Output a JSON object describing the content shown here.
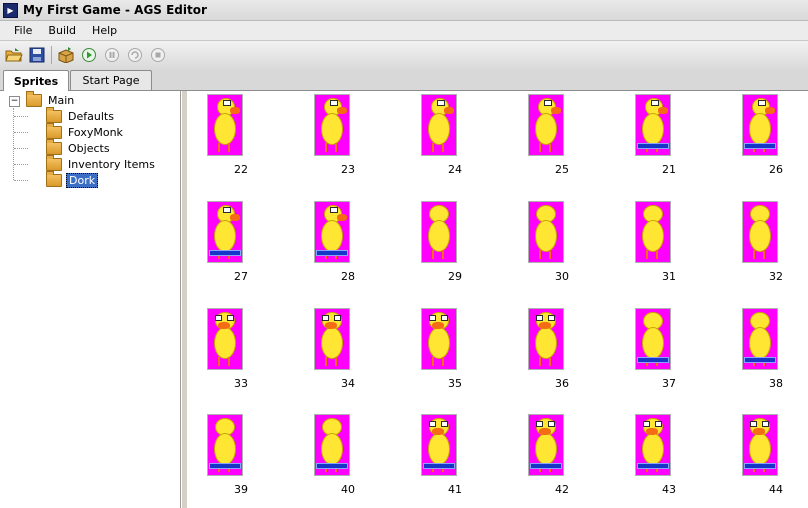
{
  "window": {
    "title": "My First Game - AGS Editor",
    "app_icon_glyph": "ags"
  },
  "menu": [
    "File",
    "Build",
    "Help"
  ],
  "toolbar_icons": [
    "open-folder-icon",
    "save-icon",
    "build-package-icon",
    "run-icon",
    "pause-icon",
    "stop-icon",
    "step-icon"
  ],
  "tabs": [
    {
      "label": "Sprites",
      "active": true
    },
    {
      "label": "Start Page",
      "active": false
    }
  ],
  "tree": {
    "root": "Main",
    "expander": "−",
    "children": [
      "Defaults",
      "FoxyMonk",
      "Objects",
      "Inventory Items",
      "Dork"
    ],
    "selected": "Dork"
  },
  "sprites": [
    {
      "num": "22",
      "pose": "side"
    },
    {
      "num": "23",
      "pose": "side"
    },
    {
      "num": "24",
      "pose": "side"
    },
    {
      "num": "25",
      "pose": "side"
    },
    {
      "num": "21",
      "pose": "side-feet"
    },
    {
      "num": "26",
      "pose": "side-feet"
    },
    {
      "num": "27",
      "pose": "side-feet"
    },
    {
      "num": "28",
      "pose": "side-feet"
    },
    {
      "num": "29",
      "pose": "back"
    },
    {
      "num": "30",
      "pose": "back"
    },
    {
      "num": "31",
      "pose": "back"
    },
    {
      "num": "32",
      "pose": "back"
    },
    {
      "num": "33",
      "pose": "front"
    },
    {
      "num": "34",
      "pose": "front"
    },
    {
      "num": "35",
      "pose": "front"
    },
    {
      "num": "36",
      "pose": "front"
    },
    {
      "num": "37",
      "pose": "back-feet"
    },
    {
      "num": "38",
      "pose": "back-feet"
    },
    {
      "num": "39",
      "pose": "back-feet"
    },
    {
      "num": "40",
      "pose": "back-feet"
    },
    {
      "num": "41",
      "pose": "front-feet"
    },
    {
      "num": "42",
      "pose": "front-feet"
    },
    {
      "num": "43",
      "pose": "front-feet"
    },
    {
      "num": "44",
      "pose": "front-feet"
    }
  ],
  "colors": {
    "sprite_bg": "#ff00ff",
    "duck_yellow": "#ffe633",
    "beak_orange": "#f46d15",
    "feet_blue": "#1636c7",
    "selection": "#3b6fc5"
  }
}
